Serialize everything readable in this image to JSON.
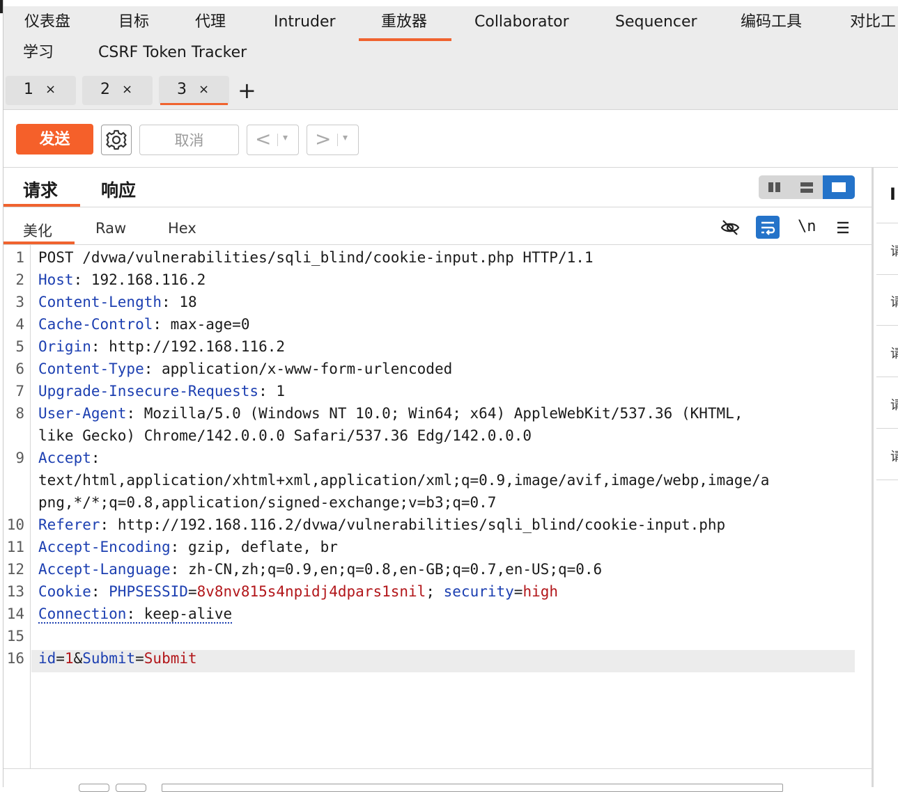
{
  "top_nav": {
    "row1": [
      "仪表盘",
      "目标",
      "代理",
      "Intruder",
      "重放器",
      "Collaborator",
      "Sequencer",
      "编码工具",
      "对比工"
    ],
    "row2": [
      "学习",
      "CSRF Token Tracker"
    ],
    "active": "重放器"
  },
  "repeater_tabs": [
    {
      "label": "1",
      "close": "×"
    },
    {
      "label": "2",
      "close": "×"
    },
    {
      "label": "3",
      "close": "×"
    }
  ],
  "add_tab": "+",
  "toolbar": {
    "send": "发送",
    "cancel": "取消",
    "prev": "<",
    "next": ">",
    "dropdown": "▾"
  },
  "panel": {
    "request_tab": "请求",
    "response_tab": "响应",
    "active": "请求"
  },
  "view_tabs": {
    "pretty": "美化",
    "raw": "Raw",
    "hex": "Hex",
    "active": "美化"
  },
  "editor_icons": {
    "newline": "\\n"
  },
  "right_panel": {
    "title": "I",
    "items": [
      "请",
      "请",
      "请",
      "请",
      "请"
    ]
  },
  "request": {
    "lines": [
      {
        "n": "1",
        "text": "POST /dvwa/vulnerabilities/sqli_blind/cookie-input.php HTTP/1.1"
      },
      {
        "n": "2",
        "name": "Host",
        "value": " 192.168.116.2"
      },
      {
        "n": "3",
        "name": "Content-Length",
        "value": " 18"
      },
      {
        "n": "4",
        "name": "Cache-Control",
        "value": " max-age=0"
      },
      {
        "n": "5",
        "name": "Origin",
        "value": " http://192.168.116.2"
      },
      {
        "n": "6",
        "name": "Content-Type",
        "value": " application/x-www-form-urlencoded"
      },
      {
        "n": "7",
        "name": "Upgrade-Insecure-Requests",
        "value": " 1"
      },
      {
        "n": "8",
        "name": "User-Agent",
        "value": " Mozilla/5.0 (Windows NT 10.0; Win64; x64) AppleWebKit/537.36 (KHTML,",
        "cont": "like Gecko) Chrome/142.0.0.0 Safari/537.36 Edg/142.0.0.0"
      },
      {
        "n": "9",
        "name": "Accept",
        "value": "",
        "cont": "text/html,application/xhtml+xml,application/xml;q=0.9,image/avif,image/webp,image/a",
        "cont2": "png,*/*;q=0.8,application/signed-exchange;v=b3;q=0.7"
      },
      {
        "n": "10",
        "name": "Referer",
        "value": " http://192.168.116.2/dvwa/vulnerabilities/sqli_blind/cookie-input.php"
      },
      {
        "n": "11",
        "name": "Accept-Encoding",
        "value": " gzip, deflate, br"
      },
      {
        "n": "12",
        "name": "Accept-Language",
        "value": " zh-CN,zh;q=0.9,en;q=0.8,en-GB;q=0.7,en-US;q=0.6"
      },
      {
        "n": "13",
        "name": "Cookie",
        "c1_name": "PHPSESSID",
        "c1_value": "8v8nv815s4npidj4dpars1snil",
        "c2_name": "security",
        "c2_value": "high"
      },
      {
        "n": "14",
        "name": "Connection",
        "value": " keep-alive"
      },
      {
        "n": "15",
        "text": ""
      },
      {
        "n": "16",
        "p1_name": "id",
        "p1_value": "1",
        "p2_name": "Submit",
        "p2_value": "Submit"
      }
    ]
  },
  "colors": {
    "accent": "#f0632f",
    "active_blue": "#2473c9",
    "header_name": "#1c3fb1",
    "param_value": "#b2161a"
  }
}
